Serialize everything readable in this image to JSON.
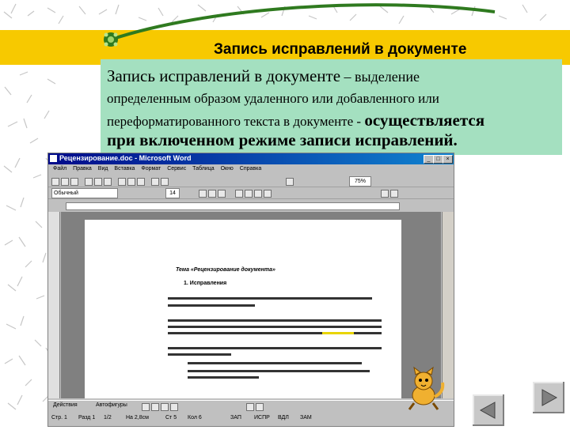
{
  "slide": {
    "title": "Запись исправлений в документе",
    "body": {
      "line1_lead": "Запись исправлений в документе",
      "line1_rest": " – выделение",
      "line2": "определенным образом  удаленного  или добавленного  или",
      "line3_lead": "переформатированного текста в документе - ",
      "line3_bold": "осуществляется",
      "line4": "при включенном режиме записи исправлений."
    }
  },
  "word": {
    "title": "Рецензирование.doc - Microsoft Word",
    "menu": [
      "Файл",
      "Правка",
      "Вид",
      "Вставка",
      "Формат",
      "Сервис",
      "Таблица",
      "Окно",
      "Справка"
    ],
    "font_name": "Обычный",
    "font_size": "14",
    "zoom": "75%",
    "doc_heading": "Тема «Рецензирование документа»",
    "doc_subheading": "1. Исправления",
    "draw_label": "Действия",
    "autoshapes_label": "Автофигуры",
    "status": [
      "Стр. 1",
      "Разд 1",
      "1/2",
      "На 2,8см",
      "Ст 5",
      "Кол 6",
      "ЗАП",
      "ИСПР",
      "ВДЛ",
      "ЗАМ"
    ]
  },
  "icons": {
    "bullet": "flower-bullet-icon",
    "mascot": "cat-mascot-icon",
    "prev": "triangle-left-icon",
    "next": "triangle-right-icon"
  },
  "colors": {
    "title_band": "#f7c900",
    "text_box": "#a4e0c0",
    "arc": "#2f7a1f"
  }
}
